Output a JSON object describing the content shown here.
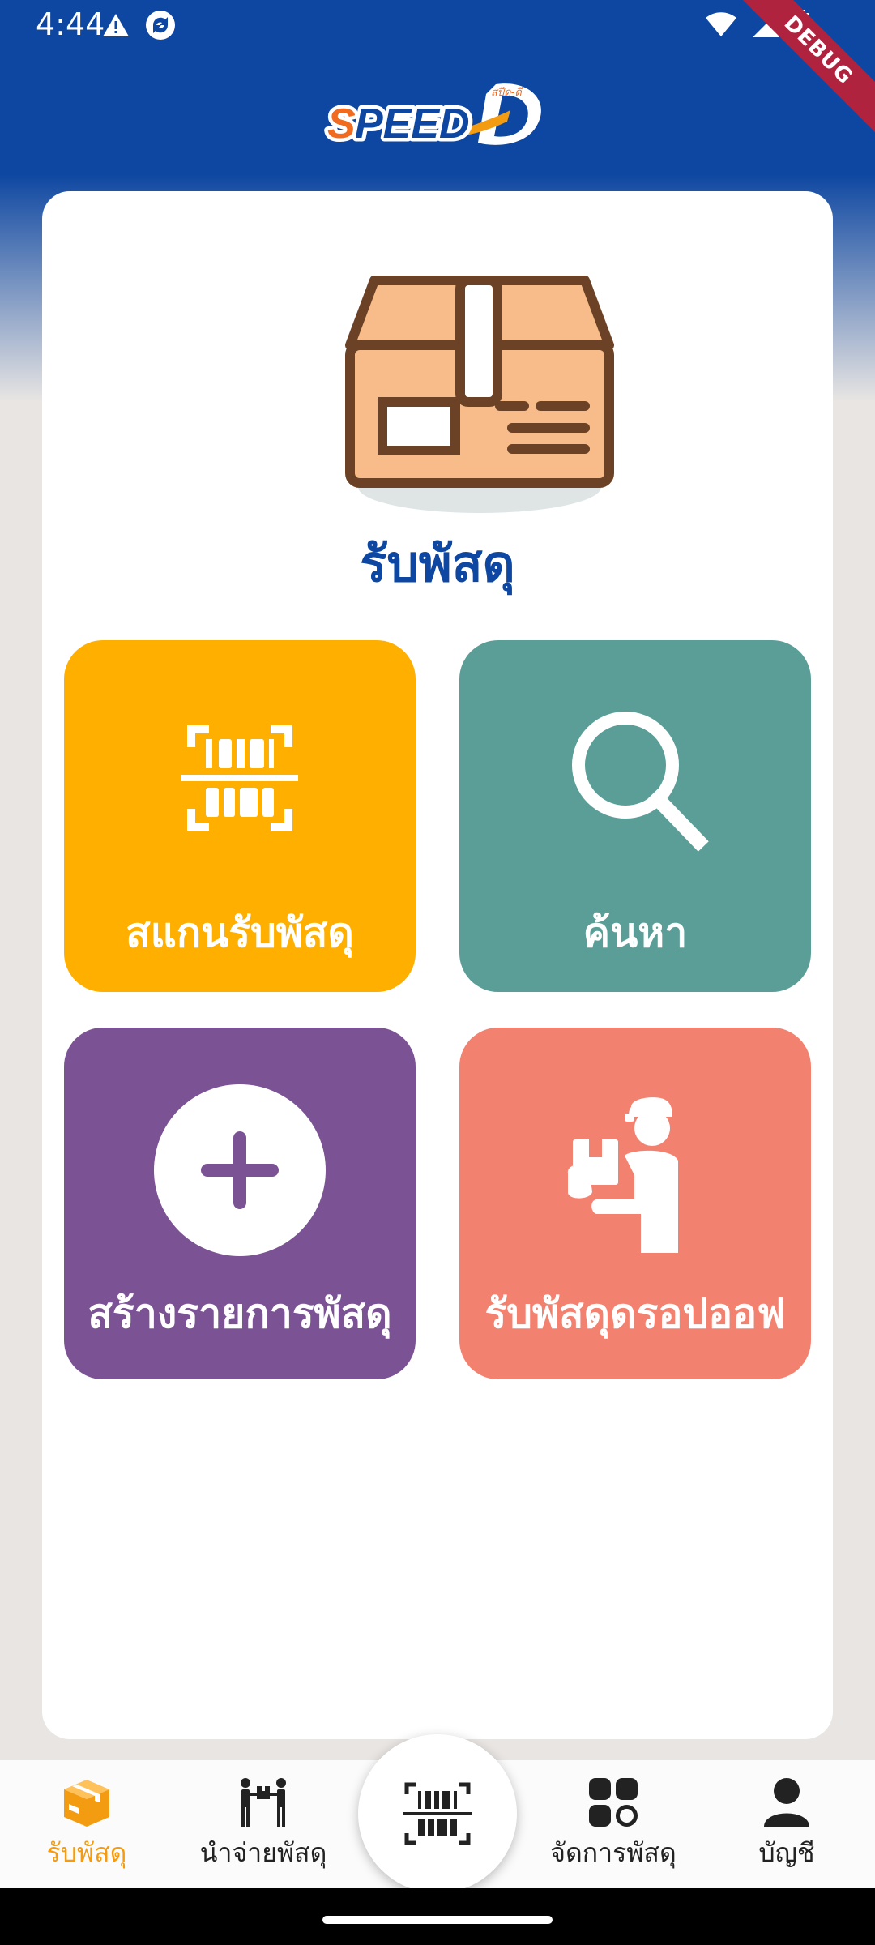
{
  "status_bar": {
    "time": "4:44",
    "debug_label": "DEBUG"
  },
  "header": {
    "logo_text": "SPEED-D",
    "logo_tag": "สปีด-ดี"
  },
  "main": {
    "title": "รับพัสดุ",
    "tiles": [
      {
        "label": "สแกนรับพัสดุ",
        "icon": "barcode-scan-icon",
        "color": "#ffaf00"
      },
      {
        "label": "ค้นหา",
        "icon": "search-icon",
        "color": "#5b9e98"
      },
      {
        "label": "สร้างรายการพัสดุ",
        "icon": "add-circle-icon",
        "color": "#7b5294"
      },
      {
        "label": "รับพัสดุดรอปออฟ",
        "icon": "courier-parcel-icon",
        "color": "#f28170"
      }
    ]
  },
  "bottom_nav": {
    "items": [
      {
        "label": "รับพัสดุ",
        "icon": "parcel-box-icon",
        "active": true
      },
      {
        "label": "นำจ่ายพัสดุ",
        "icon": "handover-icon",
        "active": false
      },
      {
        "label": "",
        "icon": "barcode-scan-icon",
        "active": false
      },
      {
        "label": "จัดการพัสดุ",
        "icon": "grid-apps-icon",
        "active": false
      },
      {
        "label": "บัญชี",
        "icon": "person-icon",
        "active": false
      }
    ],
    "active_color": "#f39c12"
  },
  "colors": {
    "primary": "#0e47a1",
    "background": "#e8e5e3"
  }
}
